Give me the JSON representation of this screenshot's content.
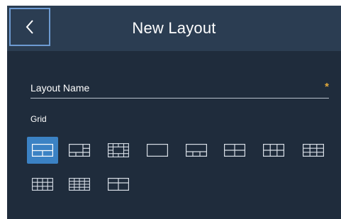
{
  "header": {
    "title": "New Layout",
    "back_icon": "chevron-left-icon"
  },
  "form": {
    "name_placeholder": "Layout Name",
    "name_value": "",
    "required_marker": "*",
    "grid_label": "Grid"
  },
  "grid_options": [
    {
      "id": "1-plus-wide",
      "selected": true
    },
    {
      "id": "1-plus-5",
      "selected": false
    },
    {
      "id": "1-plus-12",
      "selected": false
    },
    {
      "id": "1x1",
      "selected": false
    },
    {
      "id": "1-plus-3",
      "selected": false
    },
    {
      "id": "2x2",
      "selected": false
    },
    {
      "id": "3x2",
      "selected": false
    },
    {
      "id": "3x3",
      "selected": false
    },
    {
      "id": "4x3",
      "selected": false
    },
    {
      "id": "4x4",
      "selected": false
    },
    {
      "id": "2x2-split",
      "selected": false
    }
  ],
  "colors": {
    "background": "#1f2c3c",
    "header": "#2b3d52",
    "accent": "#3b82c4",
    "required": "#e2a93b"
  }
}
